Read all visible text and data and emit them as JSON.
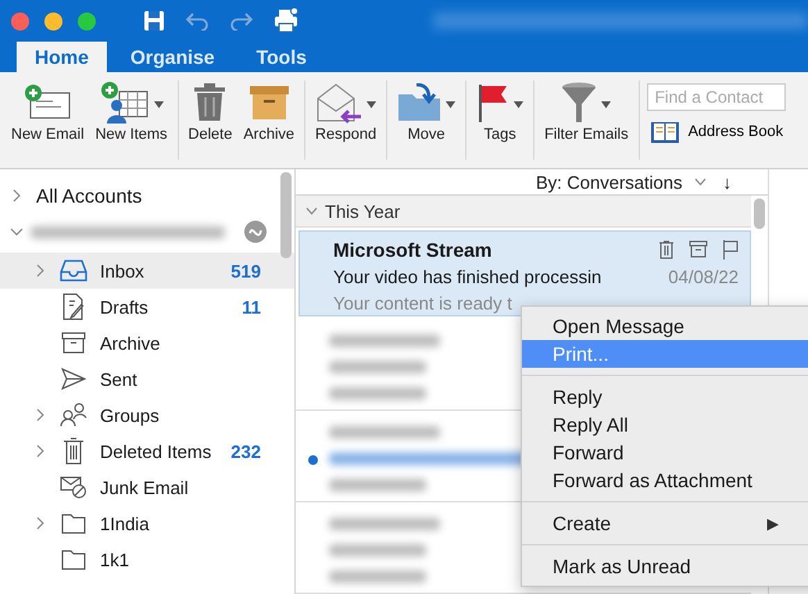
{
  "tabs": [
    {
      "label": "Home",
      "selected": true
    },
    {
      "label": "Organise",
      "selected": false
    },
    {
      "label": "Tools",
      "selected": false
    }
  ],
  "ribbon": [
    [
      {
        "kind": "new-email",
        "label": "New Email",
        "caret": false
      },
      {
        "kind": "new-items",
        "label": "New Items",
        "caret": true
      }
    ],
    [
      {
        "kind": "delete",
        "label": "Delete",
        "caret": false
      },
      {
        "kind": "archive",
        "label": "Archive",
        "caret": false
      }
    ],
    [
      {
        "kind": "respond",
        "label": "Respond",
        "caret": true
      }
    ],
    [
      {
        "kind": "move",
        "label": "Move",
        "caret": true
      }
    ],
    [
      {
        "kind": "tags",
        "label": "Tags",
        "caret": true
      }
    ],
    [
      {
        "kind": "filter",
        "label": "Filter Emails",
        "caret": true
      }
    ]
  ],
  "contact_search": {
    "placeholder": "Find a Contact"
  },
  "address_book": "Address Book",
  "sidebar": {
    "all_accounts": "All Accounts",
    "expanded": false,
    "folders": [
      {
        "kind": "inbox",
        "label": "Inbox",
        "count": "519",
        "expandable": true,
        "selected": true
      },
      {
        "kind": "drafts",
        "label": "Drafts",
        "count": "11",
        "expandable": false,
        "selected": false
      },
      {
        "kind": "archive",
        "label": "Archive",
        "expandable": false,
        "selected": false
      },
      {
        "kind": "sent",
        "label": "Sent",
        "expandable": false,
        "selected": false
      },
      {
        "kind": "groups",
        "label": "Groups",
        "expandable": true,
        "selected": false
      },
      {
        "kind": "deleted",
        "label": "Deleted Items",
        "count": "232",
        "expandable": true,
        "selected": false
      },
      {
        "kind": "junk",
        "label": "Junk Email",
        "expandable": false,
        "selected": false
      },
      {
        "kind": "folder",
        "label": "1India",
        "expandable": true,
        "selected": false
      },
      {
        "kind": "folder",
        "label": "1k1",
        "expandable": false,
        "selected": false
      }
    ]
  },
  "message_list": {
    "sort": "By: Conversations",
    "sort_arrow": "↓",
    "group": "This Year",
    "messages": [
      {
        "kind": "message",
        "sender": "Microsoft Stream",
        "subject": "Your video has finished processin",
        "date": "04/08/22",
        "preview": "Your content is ready t",
        "selected": true,
        "unread": false
      },
      {
        "kind": "blurred",
        "selected": false,
        "unread": false
      },
      {
        "kind": "blurred",
        "selected": false,
        "unread": true
      },
      {
        "kind": "blurred",
        "selected": false,
        "unread": false
      }
    ]
  },
  "context_menu": [
    {
      "kind": "item",
      "label": "Open Message",
      "selected": false
    },
    {
      "kind": "item",
      "label": "Print...",
      "selected": true
    },
    {
      "kind": "separator"
    },
    {
      "kind": "item",
      "label": "Reply",
      "selected": false
    },
    {
      "kind": "item",
      "label": "Reply All",
      "selected": false
    },
    {
      "kind": "item",
      "label": "Forward",
      "selected": false
    },
    {
      "kind": "item",
      "label": "Forward as Attachment",
      "selected": false
    },
    {
      "kind": "separator"
    },
    {
      "kind": "item",
      "label": "Create",
      "submenu": "▶",
      "selected": false
    },
    {
      "kind": "separator"
    },
    {
      "kind": "item",
      "label": "Mark as Unread",
      "selected": false
    }
  ]
}
